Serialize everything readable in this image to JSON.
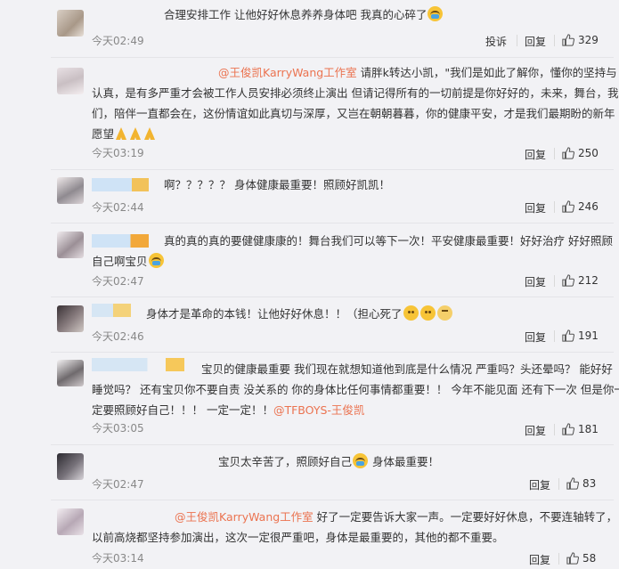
{
  "comments": [
    {
      "text1": "合理安排工作 让他好好休息养养身体吧 我真的心碎了",
      "time": "今天02:49",
      "report": "投诉",
      "reply": "回复",
      "likes": "329"
    },
    {
      "mention": "@王俊凯KarryWang工作室",
      "text1": " 请胖k转达小凯，\"我们是如此了解你，懂你的坚持与",
      "text2": "认真，是有多严重才会被工作人员安排必须终止演出 但请记得所有的一切前提是你好好的，未来，舞台，我",
      "text3": "们，陪伴一直都会在，这份情谊如此真切与深厚，又岂在朝朝暮暮，你的健康平安，才是我们最期盼的新年",
      "text4": "愿望",
      "time": "今天03:19",
      "reply": "回复",
      "likes": "250"
    },
    {
      "text1": "啊？？？？？ 身体健康最重要！照顾好凯凯！",
      "time": "今天02:44",
      "reply": "回复",
      "likes": "246"
    },
    {
      "text1": "真的真的真的要健健康康的！舞台我们可以等下一次！平安健康最重要！好好治疗 好好照顾",
      "text2": "自己啊宝贝",
      "time": "今天02:47",
      "reply": "回复",
      "likes": "212"
    },
    {
      "text1": "身体才是革命的本钱！让他好好休息！！（担心死了",
      "text1end": "",
      "time": "今天02:46",
      "reply": "回复",
      "likes": "191"
    },
    {
      "text1": "宝贝的健康最重要 我们现在就想知道他到底是什么情况 严重吗？头还晕吗？ 能好好",
      "text2": "睡觉吗？ 还有宝贝你不要自责 没关系的 你的身体比任何事情都重要！！ 今年不能见面 还有下一次 但是你一",
      "text3": "定要照顾好自己！！！ 一定一定！！",
      "mention3": "@TFBOYS-王俊凯",
      "time": "今天03:05",
      "reply": "回复",
      "likes": "181"
    },
    {
      "text1": "宝贝太辛苦了，照顾好自己",
      "text1end": " 身体最重要！",
      "time": "今天02:47",
      "reply": "回复",
      "likes": "83"
    },
    {
      "mention": "@王俊凯KarryWang工作室",
      "text1": " 好了一定要告诉大家一声。一定要好好休息，不要连轴转了，",
      "text2": "以前高烧都坚持参加演出，这次一定很严重吧，身体是最重要的，其他的都不重要。",
      "time": "今天03:14",
      "reply": "回复",
      "likes": "58"
    }
  ],
  "colors": {
    "background": "#f2f2f5",
    "mention": "#eb7350",
    "time": "#888888",
    "text": "#333333"
  }
}
